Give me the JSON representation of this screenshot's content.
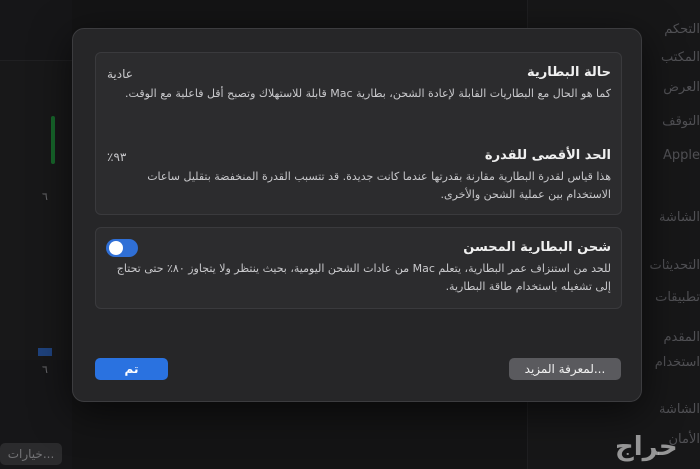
{
  "background": {
    "left_numbers": [
      "٦",
      "٦"
    ],
    "options_button_label": "خيارات...",
    "right_sidebar_items": [
      "التحكم",
      "المكتب",
      "العرض",
      "التوقف",
      "Apple",
      "الشاشة",
      "التحديثات",
      "تطبيقات",
      "المقدم",
      "استخدام",
      "الشاشة",
      "الأمان"
    ]
  },
  "dialog": {
    "battery_condition": {
      "title": "حالة البطارية",
      "value": "عادية",
      "description": "كما هو الحال مع البطاريات القابلة لإعادة الشحن، بطارية Mac قابلة للاستهلاك وتصبح أقل فاعلية مع الوقت."
    },
    "maximum_capacity": {
      "title": "الحد الأقصى للقدرة",
      "value": "٪٩٣",
      "description": "هذا قياس لقدرة البطارية مقارنة بقدرتها عندما كانت جديدة. قد تتسبب القدرة المنخفضة بتقليل ساعات الاستخدام بين عملية الشحن والأخرى."
    },
    "optimized_charging": {
      "title": "شحن البطارية المحسن",
      "enabled": false,
      "description": "للحد من استنزاف عمر البطارية، يتعلم Mac من عادات الشحن اليومية، بحيث ينتظر ولا يتجاوز ٨٠٪ حتى تحتاج إلى تشغيله باستخدام طاقة البطارية."
    },
    "learn_more_label": "لمعرفة المزيد...",
    "done_label": "تم",
    "accent_color": "#2a72e0"
  },
  "watermark_text": "حراج"
}
